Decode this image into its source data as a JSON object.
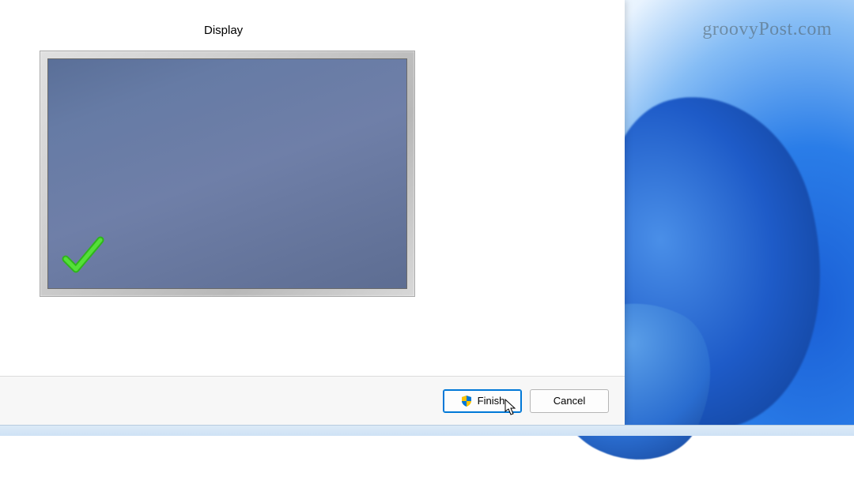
{
  "watermark": "groovyPost.com",
  "dialog": {
    "section_label": "Display",
    "buttons": {
      "finish": "Finish",
      "cancel": "Cancel"
    }
  }
}
